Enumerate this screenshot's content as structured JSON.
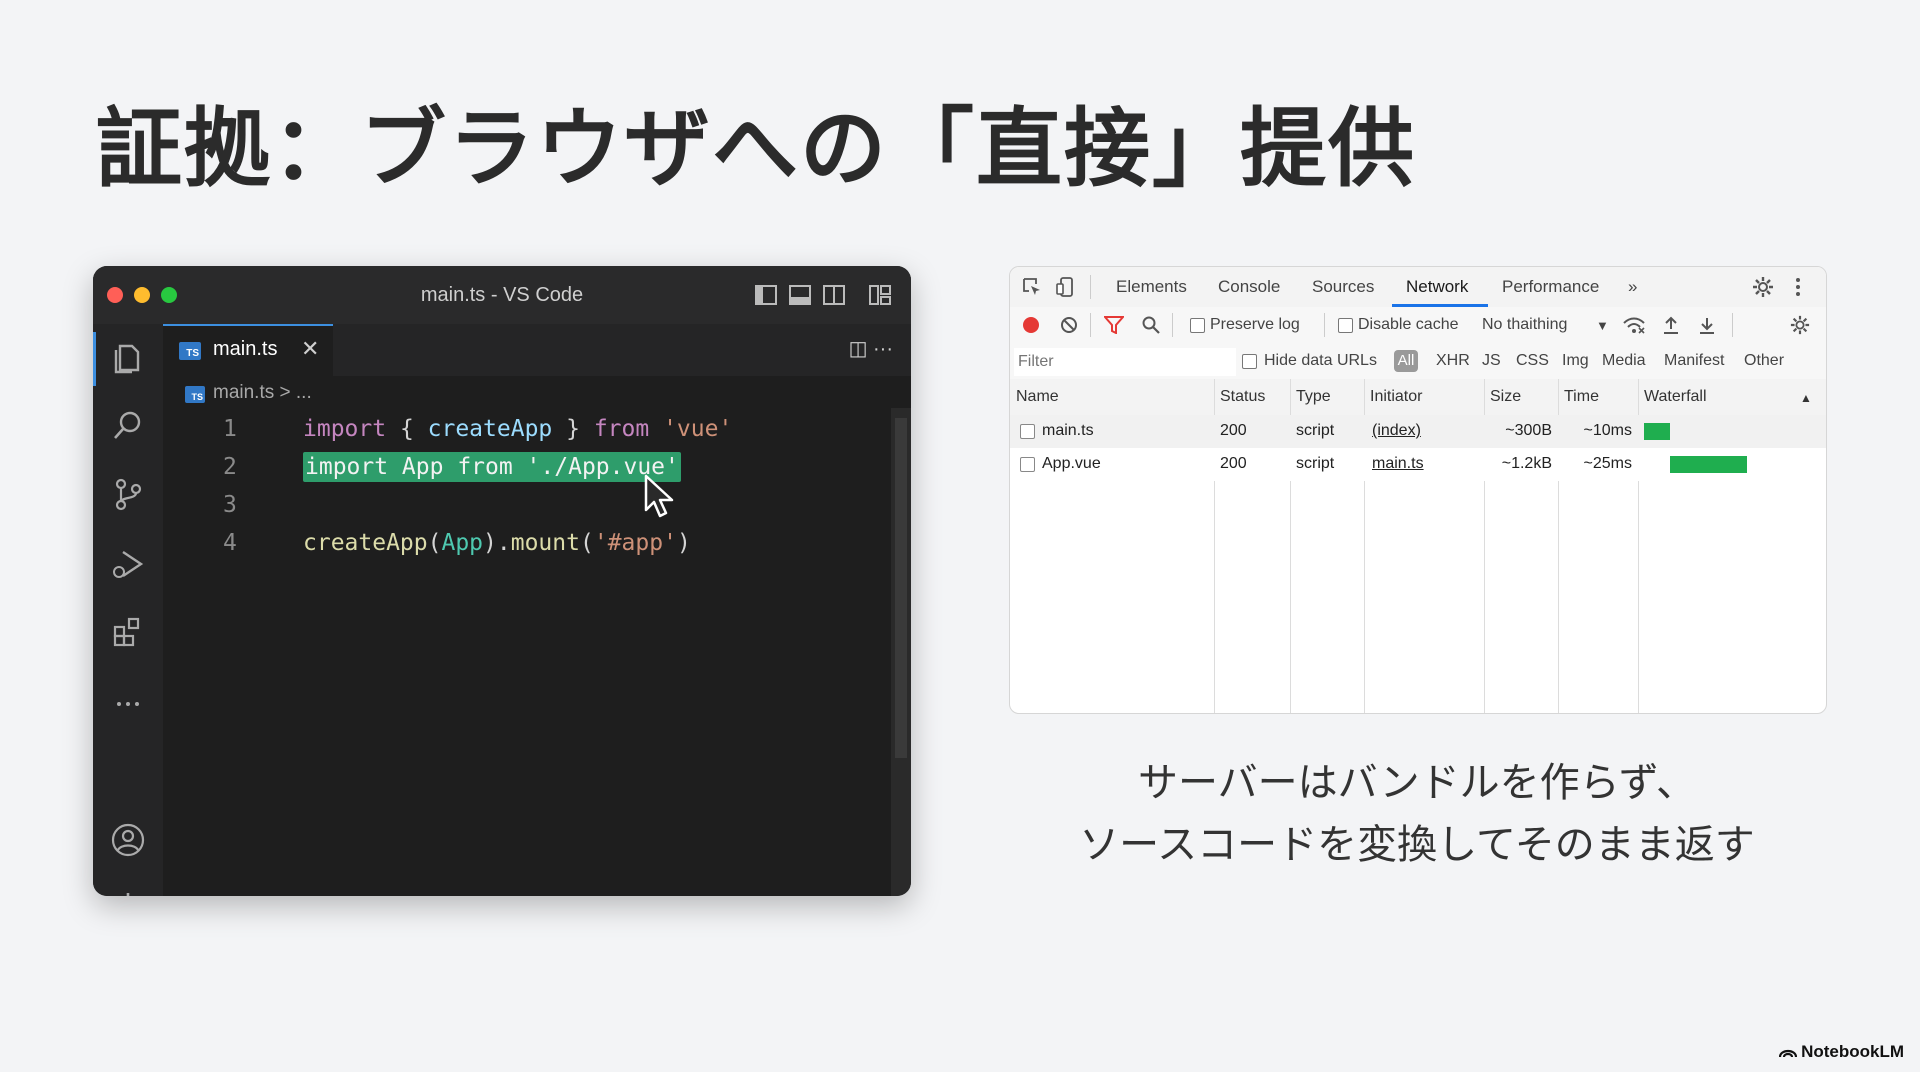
{
  "slide": {
    "title": "証拠：ブラウザへの「直接」提供",
    "caption_line1": "サーバーはバンドルを作らず、",
    "caption_line2": "ソースコードを変換してそのまま返す",
    "brand": "NotebookLM"
  },
  "vscode": {
    "window_title": "main.ts - VS Code",
    "tab": {
      "label": "main.ts",
      "close": "✕",
      "badge": "TS"
    },
    "tab_actions": "◫  ···",
    "breadcrumb": {
      "file": "main.ts",
      "rest": "> ..."
    },
    "lines": [
      {
        "num": "1",
        "tokens": [
          "import",
          " { ",
          "createApp",
          " } ",
          "from",
          " ",
          "'vue'"
        ]
      },
      {
        "num": "2",
        "text": "import App from './App.vue'"
      },
      {
        "num": "3",
        "text": ""
      },
      {
        "num": "4",
        "tokens": [
          "createApp",
          "(",
          "App",
          ").",
          "mount",
          "(",
          "'#app'",
          ")"
        ]
      }
    ],
    "activity_icons": [
      "explorer-icon",
      "search-icon",
      "source-control-icon",
      "run-debug-icon",
      "extensions-icon",
      "more-icon",
      "account-icon",
      "settings-gear-icon"
    ]
  },
  "devtools": {
    "tabs": [
      "Elements",
      "Console",
      "Sources",
      "Network",
      "Performance",
      "»"
    ],
    "active_tab": "Network",
    "toolbar": {
      "preserve_log": "Preserve log",
      "disable_cache": "Disable cache",
      "throttle": "No thaithing",
      "throttle_caret": "▼"
    },
    "filter": {
      "placeholder": "Filter",
      "hide_data_urls": "Hide data URLs",
      "types": [
        "All",
        "XHR",
        "JS",
        "CSS",
        "Img",
        "Media",
        "Manifest",
        "Other"
      ]
    },
    "columns": [
      "Name",
      "Status",
      "Type",
      "Initiator",
      "Size",
      "Time",
      "Waterfall"
    ],
    "sort_arrow": "▲",
    "rows": [
      {
        "name": "main.ts",
        "status": "200",
        "type": "script",
        "initiator": "(index)",
        "size": "~300B",
        "time": "~10ms",
        "waterfall_start": 0.0,
        "waterfall_length": 0.15
      },
      {
        "name": "App.vue",
        "status": "200",
        "type": "script",
        "initiator": "main.ts",
        "size": "~1.2kB",
        "time": "~25ms",
        "waterfall_start": 0.15,
        "waterfall_length": 0.45
      }
    ],
    "colors": {
      "record": "#e53935",
      "accent": "#1a73e8",
      "waterfall": "#1fae4f"
    }
  },
  "colors": {
    "highlight": "#2e9d6b",
    "ts_badge": "#3178c6"
  }
}
